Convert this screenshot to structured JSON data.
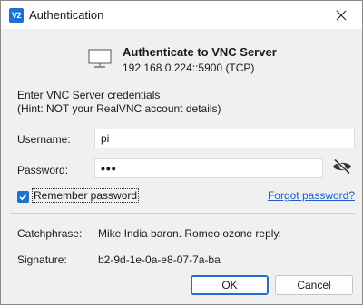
{
  "window": {
    "title": "Authentication",
    "app_icon_text": "V2",
    "close_symbol": "×"
  },
  "header": {
    "heading": "Authenticate to VNC Server",
    "address": "192.168.0.224::5900 (TCP)"
  },
  "instructions": {
    "line1": "Enter VNC Server credentials",
    "line2": "(Hint: NOT your RealVNC account details)"
  },
  "form": {
    "username_label": "Username:",
    "username_value": "pi",
    "password_label": "Password:",
    "password_value": "•••",
    "remember_label": "Remember password",
    "remember_checked": true,
    "forgot_link": "Forgot password?"
  },
  "info": {
    "catchphrase_label": "Catchphrase:",
    "catchphrase_value": "Mike India baron. Romeo ozone reply.",
    "signature_label": "Signature:",
    "signature_value": "b2-9d-1e-0a-e8-07-7a-ba"
  },
  "buttons": {
    "ok": "OK",
    "cancel": "Cancel"
  },
  "icons": {
    "app": "vnc-viewer-icon",
    "close": "close-icon",
    "monitor": "monitor-icon",
    "eye": "eye-slash-icon",
    "check": "check-icon"
  },
  "colors": {
    "accent": "#1f6fd1",
    "link": "#1a5ecf",
    "background": "#f0f0f0"
  }
}
